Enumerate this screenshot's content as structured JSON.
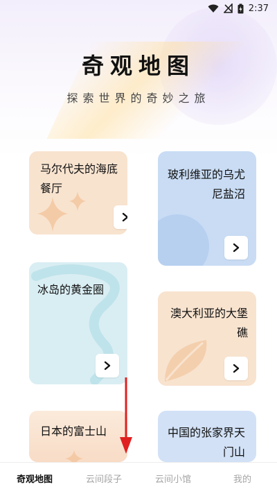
{
  "status": {
    "time": "2:37"
  },
  "header": {
    "title": "奇观地图",
    "subtitle": "探索世界的奇妙之旅"
  },
  "cards": [
    {
      "title": "马尔代夫的海底餐厅",
      "color": "#f8e3cf"
    },
    {
      "title": "玻利维亚的乌尤尼盐沼",
      "color": "#c9dcf4"
    },
    {
      "title": "冰岛的黄金圈",
      "color": "#d9eef3"
    },
    {
      "title": "澳大利亚的大堡礁",
      "color": "#f8e3cf"
    },
    {
      "title": "日本的富士山",
      "color": "#f8e3cf"
    },
    {
      "title": "中国的张家界天门山",
      "color": "#d2e1f6"
    }
  ],
  "tabs": [
    {
      "label": "奇观地图",
      "active": true
    },
    {
      "label": "云间段子",
      "active": false
    },
    {
      "label": "云间小馆",
      "active": false
    },
    {
      "label": "我的",
      "active": false
    }
  ],
  "accent": "#e02020"
}
